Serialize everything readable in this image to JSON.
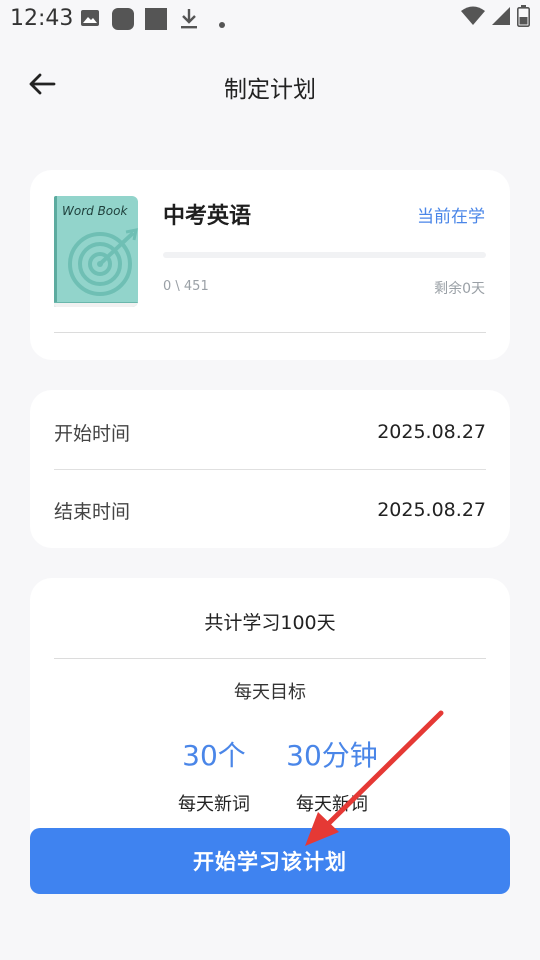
{
  "status_bar": {
    "time": "12:43",
    "left_icons": [
      "image-icon",
      "app-icon",
      "square-icon",
      "download-icon",
      "dot-icon"
    ],
    "right_icons": [
      "wifi-icon",
      "signal-icon",
      "battery-icon"
    ]
  },
  "header": {
    "title": "制定计划",
    "back_icon": "arrow-left-icon"
  },
  "book": {
    "cover_title": "Word Book",
    "cover_color": "#92d4cb",
    "name": "中考英语",
    "status": "当前在学",
    "progress_fraction": 0,
    "progress_text": "0 \\ 451",
    "remaining_text": "剩余0天"
  },
  "dates": {
    "start_label": "开始时间",
    "start_value": "2025.08.27",
    "end_label": "结束时间",
    "end_value": "2025.08.27"
  },
  "summary": {
    "total_text": "共计学习100天",
    "goal_label": "每天目标",
    "words_value": "30个",
    "words_caption": "每天新词",
    "time_value": "30分钟",
    "time_caption": "每天新词"
  },
  "start_button": {
    "label": "开始学习该计划",
    "color": "#3f83f0"
  },
  "accent_color": "#4a86e8",
  "annotation_color": "#e53935"
}
